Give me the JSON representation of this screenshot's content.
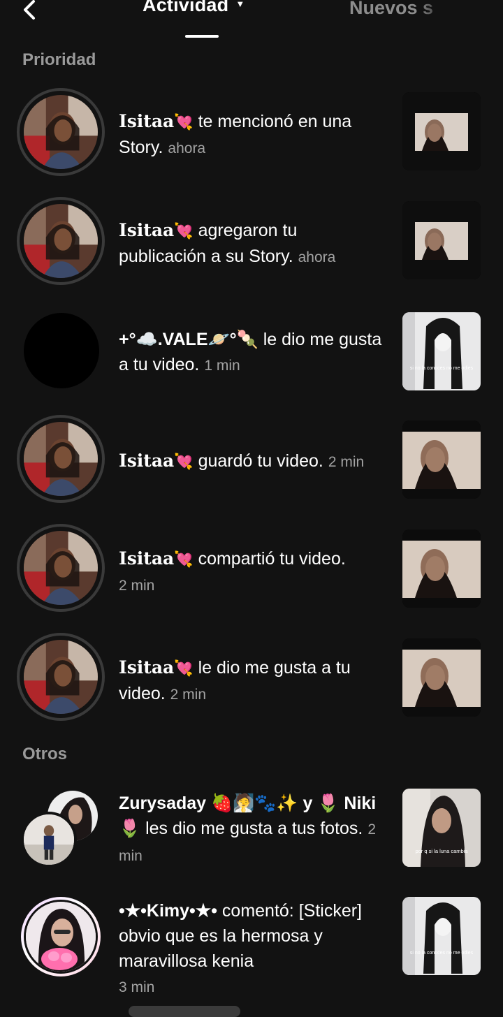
{
  "header": {
    "back_icon": "chevron-left-icon",
    "active_tab": "Actividad",
    "other_tab": "Nuevos s"
  },
  "sections": {
    "priority": "Prioridad",
    "others": "Otros"
  },
  "priority_items": [
    {
      "user": "Isitaa",
      "action": "te mencionó en una Story.",
      "time": "ahora"
    },
    {
      "user": "Isitaa",
      "action": "agregaron tu publicación a su Story.",
      "time": "ahora"
    },
    {
      "user": "+°☁️.VALE🪐°🍡",
      "action": "le dio me gusta a tu video.",
      "time": "1 min"
    },
    {
      "user": "Isitaa",
      "action": "guardó tu video.",
      "time": "2 min"
    },
    {
      "user": "Isitaa",
      "action": "compartió tu video.",
      "time": "2 min"
    },
    {
      "user": "Isitaa",
      "action": "le dio me gusta a tu video.",
      "time": "2 min"
    }
  ],
  "other_items": [
    {
      "user": "Zurysaday 🍓🧖🐾✨ y 🌷 Niki🌷",
      "action": "les dio me gusta a tus fotos.",
      "time": "2 min"
    },
    {
      "user": "•★•Kimy•★•",
      "action": "comentó: [Sticker] obvio que es la hermosa y maravillosa kenia",
      "time": "3 min"
    }
  ],
  "thumb_captions": {
    "wig": "si no la conoces no me odies",
    "luna": "por q si la luna cambia"
  },
  "colors": {
    "background": "#121212",
    "heart": "#ff5fa2",
    "muted": "#a3a3a3"
  }
}
